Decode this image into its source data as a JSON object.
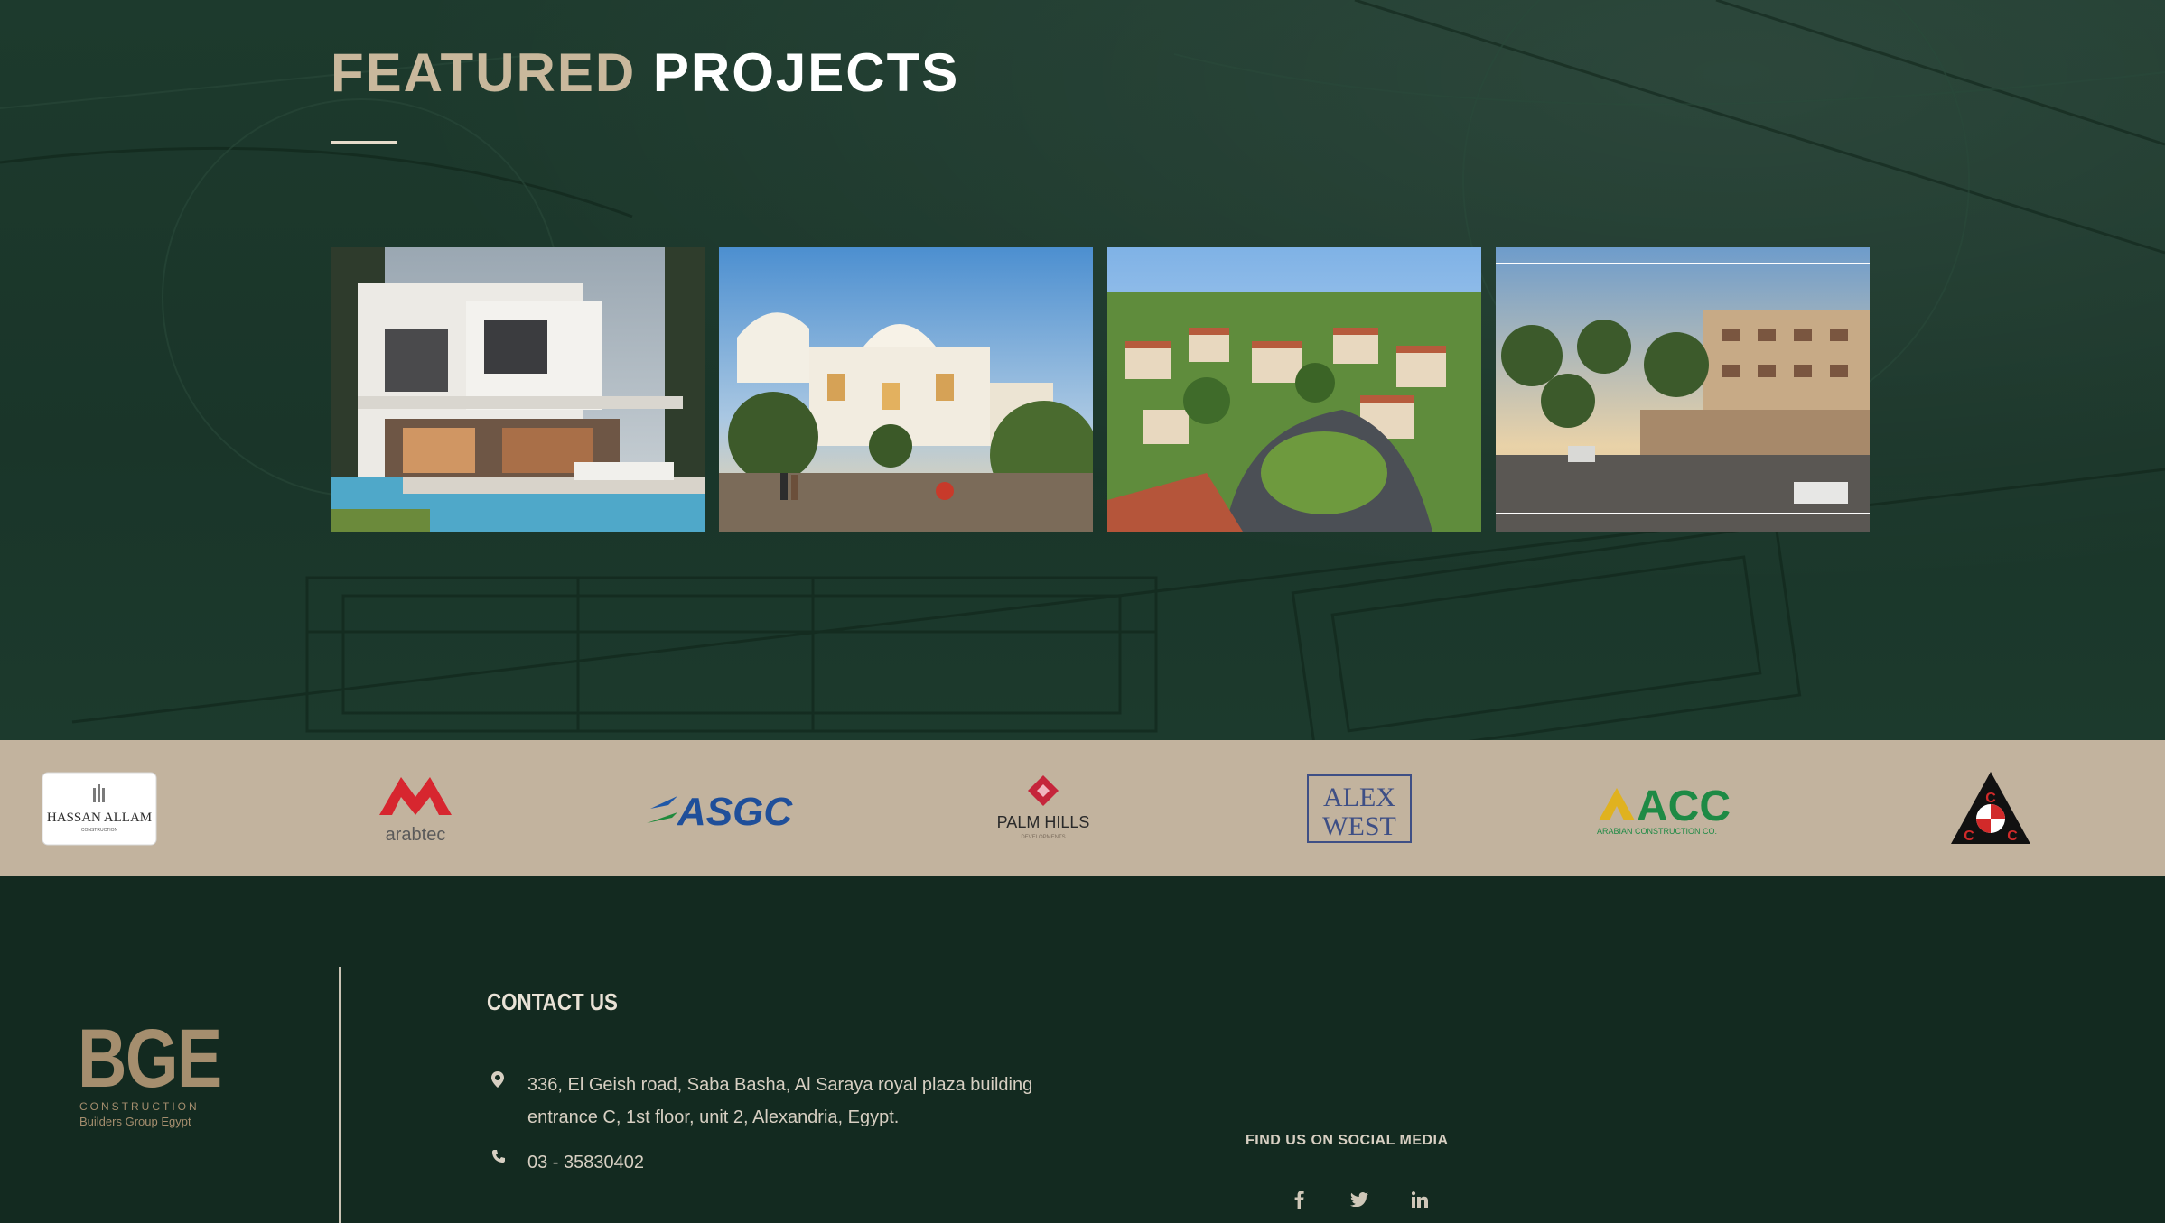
{
  "featured": {
    "title_word1": "FEATURED",
    "title_word2": "PROJECTS"
  },
  "projects": [
    {
      "name": "modern-villa-pool"
    },
    {
      "name": "mediterranean-villas"
    },
    {
      "name": "aerial-compound"
    },
    {
      "name": "residential-entrance"
    }
  ],
  "partners": [
    {
      "name": "hassan-allam-logo",
      "text": "Hassan Allam",
      "sub": "CONSTRUCTION"
    },
    {
      "name": "arabtec-logo",
      "text": "arabtec"
    },
    {
      "name": "asgc-logo",
      "text": "ASGC"
    },
    {
      "name": "palm-hills-logo",
      "text": "PALM HILLS"
    },
    {
      "name": "alex-west-logo",
      "text1": "ALEX",
      "text2": "WEST"
    },
    {
      "name": "acc-logo",
      "text": "ACC",
      "sub": "ARABIAN CONSTRUCTION CO."
    },
    {
      "name": "ccc-logo",
      "text": "C"
    }
  ],
  "footer": {
    "logo": {
      "main": "BGE",
      "sub1": "CONSTRUCTION",
      "sub2": "Builders Group Egypt"
    },
    "contact_title": "CONTACT US",
    "address_line1": "336, El Geish road, Saba Basha, Al Saraya royal plaza building",
    "address_line2": "entrance C, 1st floor, unit 2, Alexandria, Egypt.",
    "phone": "03 - 35830402",
    "social_title": "FIND US ON SOCIAL MEDIA",
    "social": [
      {
        "name": "facebook-icon",
        "glyph": "f"
      },
      {
        "name": "twitter-icon",
        "glyph": "t"
      },
      {
        "name": "linkedin-icon",
        "glyph": "in"
      }
    ]
  },
  "colors": {
    "dark_green": "#132a20",
    "section_green": "#1d3a2d",
    "beige_strip": "#c2b39e",
    "title_gold": "#c9b89c",
    "logo_gold": "#a58e6e"
  }
}
